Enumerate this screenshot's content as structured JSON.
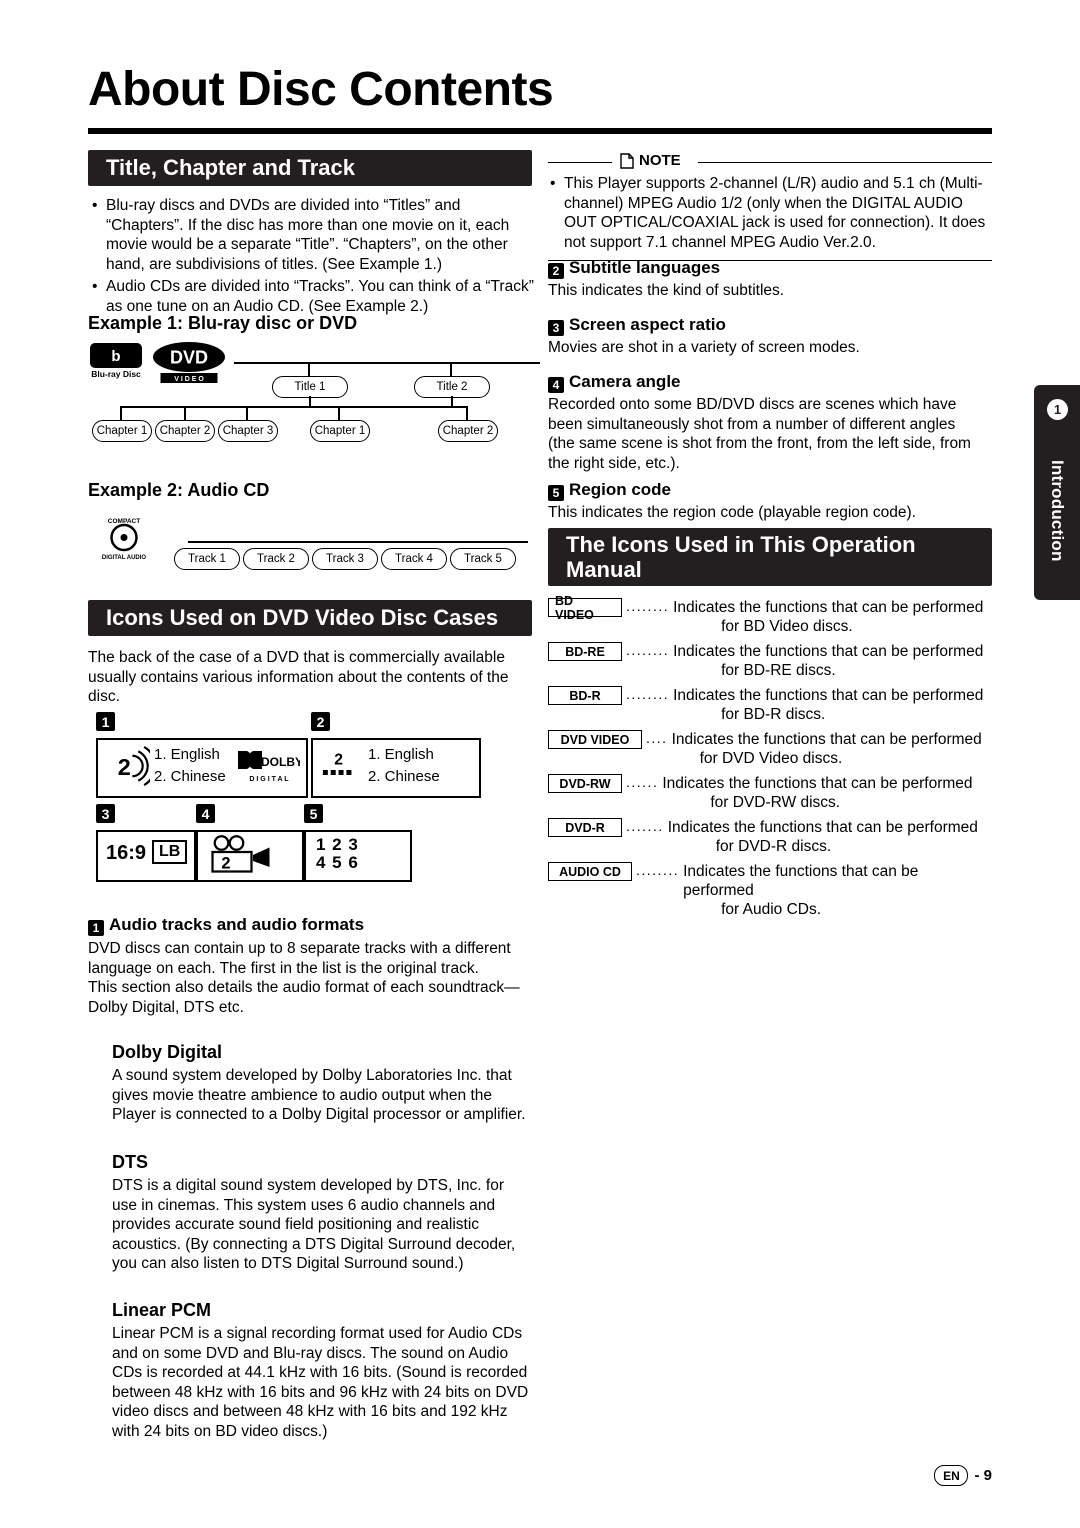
{
  "page": {
    "title": "About Disc Contents",
    "footer_locale": "EN",
    "footer_page": "- 9",
    "side_tab_number": "1",
    "side_tab_label": "Introduction"
  },
  "section_title_chapter_track": {
    "heading": "Title, Chapter and Track",
    "bullets": [
      "Blu-ray discs and DVDs are divided into “Titles” and “Chapters”. If the disc has more than one movie on it, each movie would be a separate “Title”. “Chapters”, on the other hand, are subdivisions of titles. (See Example 1.)",
      "Audio CDs are divided into “Tracks”. You can think of a “Track” as one tune on an Audio CD. (See Example 2.)"
    ],
    "example1_heading": "Example 1: Blu-ray disc or DVD",
    "example1": {
      "logo_bluray_top": "Blu-ray Disc",
      "logo_dvd_top": "DVD",
      "logo_dvd_bottom": "V I D E O",
      "titles": [
        "Title 1",
        "Title 2"
      ],
      "chapters_title1": [
        "Chapter 1",
        "Chapter 2",
        "Chapter 3"
      ],
      "chapters_title2": [
        "Chapter 1",
        "Chapter 2"
      ]
    },
    "example2_heading": "Example 2: Audio CD",
    "example2": {
      "logo_line1": "COMPACT",
      "logo_line2": "disc",
      "logo_line3": "DIGITAL AUDIO",
      "tracks": [
        "Track 1",
        "Track 2",
        "Track 3",
        "Track 4",
        "Track 5"
      ]
    }
  },
  "section_icons_dvd_cases": {
    "heading": "Icons Used on DVD Video Disc Cases",
    "intro": "The back of the case of a DVD that is commercially available usually contains various information about the contents of the disc.",
    "markers": [
      "1",
      "2",
      "3",
      "4",
      "5"
    ],
    "box1": {
      "speaker_label": "2",
      "lines": [
        "1. English",
        "2. Chinese"
      ],
      "dolby_top": "DOLBY",
      "dolby_bottom": "D I G I T A L"
    },
    "box2": {
      "sub_label": "2",
      "lines": [
        "1. English",
        "2. Chinese"
      ]
    },
    "box3": {
      "aspect": "16:9",
      "lb": "LB"
    },
    "box4": {
      "angle_count": "2"
    },
    "box5": {
      "row1": "1 2 3",
      "row2": "4 5 6"
    },
    "items": [
      {
        "num": "1",
        "title": "Audio tracks and audio formats",
        "body": "DVD discs can contain up to 8 separate tracks with a different language on each. The first in the list is the original track.\nThis section also details the audio format of each soundtrack—Dolby Digital, DTS etc."
      }
    ],
    "dolby_digital": {
      "heading": "Dolby Digital",
      "body": "A sound system developed by Dolby Laboratories Inc. that gives movie theatre ambience to audio output when the Player is connected to a Dolby Digital processor or amplifier."
    },
    "dts": {
      "heading": "DTS",
      "body": "DTS is a digital sound system developed by DTS, Inc. for use in cinemas. This system uses 6 audio channels and provides accurate sound field positioning and realistic acoustics. (By connecting a DTS Digital Surround decoder, you can also listen to DTS Digital Surround sound.)"
    },
    "linear_pcm": {
      "heading": "Linear PCM",
      "body": "Linear PCM is a signal recording format used for Audio CDs and on some DVD and Blu-ray discs. The sound on Audio CDs is recorded at 44.1 kHz with 16 bits. (Sound is recorded between 48 kHz with 16 bits and 96 kHz with 24 bits on DVD video discs and between 48 kHz with 16 bits and 192 kHz with 24 bits on BD video discs.)"
    }
  },
  "note": {
    "label": "NOTE",
    "bullet": "This Player supports 2-channel (L/R) audio and 5.1 ch (Multi-channel) MPEG Audio 1/2 (only when the DIGITAL AUDIO OUT OPTICAL/COAXIAL jack is used for connection). It does not support 7.1 channel MPEG Audio Ver.2.0."
  },
  "right_items": [
    {
      "num": "2",
      "title": "Subtitle languages",
      "body": "This indicates the kind of subtitles."
    },
    {
      "num": "3",
      "title": "Screen aspect ratio",
      "body": "Movies are shot in a variety of screen modes."
    },
    {
      "num": "4",
      "title": "Camera angle",
      "body": "Recorded onto some BD/DVD discs are scenes which have been simultaneously shot from a number of different angles (the same scene is shot from the front, from the left side, from the right side, etc.)."
    },
    {
      "num": "5",
      "title": "Region code",
      "body": "This indicates the region code (playable region code)."
    }
  ],
  "section_manual_icons": {
    "heading": "The Icons Used in This Operation Manual",
    "rows": [
      {
        "tag": "BD VIDEO",
        "dots": "........",
        "line1": "Indicates the functions that can be performed",
        "line2": "for BD Video discs."
      },
      {
        "tag": "BD-RE",
        "dots": "........",
        "line1": "Indicates the functions that can be performed",
        "line2": "for BD-RE discs."
      },
      {
        "tag": "BD-R",
        "dots": "........",
        "line1": "Indicates the functions that can be performed",
        "line2": "for BD-R discs."
      },
      {
        "tag": "DVD VIDEO",
        "dots": "....",
        "line1": "Indicates the functions that can be performed",
        "line2": "for DVD Video discs."
      },
      {
        "tag": "DVD-RW",
        "dots": "......",
        "line1": "Indicates the functions that can be performed",
        "line2": "for DVD-RW discs."
      },
      {
        "tag": "DVD-R",
        "dots": ".......",
        "line1": "Indicates the functions that can be performed",
        "line2": "for DVD-R discs."
      },
      {
        "tag": "AUDIO CD",
        "dots": "........",
        "line1": "Indicates the functions that can be performed",
        "line2": "for Audio CDs."
      }
    ]
  }
}
